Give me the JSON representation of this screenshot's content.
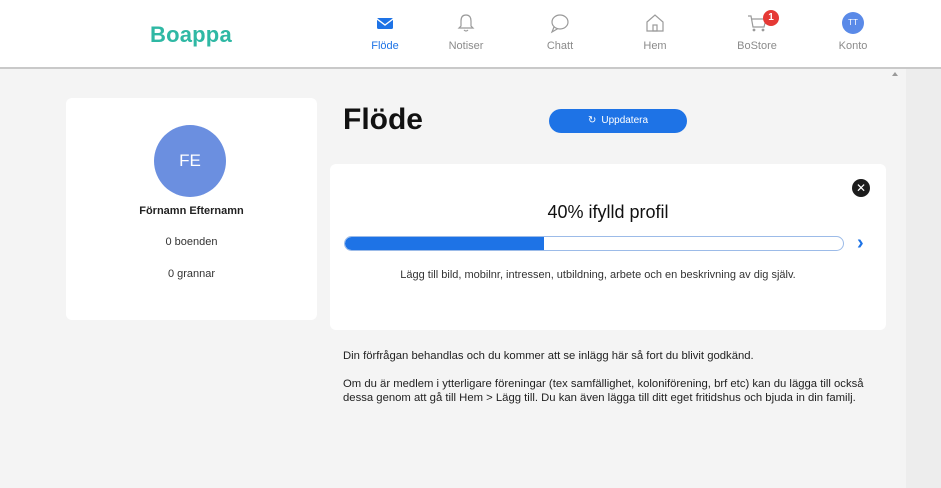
{
  "app": {
    "logo": "Boappa"
  },
  "nav": {
    "items": [
      {
        "label": "Flöde",
        "icon": "envelope-icon",
        "active": true
      },
      {
        "label": "Notiser",
        "icon": "bell-icon"
      },
      {
        "label": "Chatt",
        "icon": "chat-bubble-icon"
      },
      {
        "label": "Hem",
        "icon": "home-icon"
      },
      {
        "label": "BoStore",
        "icon": "cart-icon",
        "badge": "1"
      },
      {
        "label": "Konto",
        "icon": "avatar",
        "initials": "TT"
      }
    ]
  },
  "profile": {
    "initials": "FE",
    "name": "Förnamn Efternamn",
    "residents": "0 boenden",
    "neighbors": "0 grannar"
  },
  "feed": {
    "title": "Flöde",
    "refresh_label": "Uppdatera",
    "refresh_icon": "refresh-icon"
  },
  "profile_progress": {
    "title": "40% ifylld profil",
    "fraction": 0.4,
    "hint": "Lägg till bild, mobilnr, intressen, utbildning, arbete och en beskrivning av dig själv."
  },
  "info": {
    "p1": "Din förfrågan behandlas och du kommer att se inlägg här så fort du blivit godkänd.",
    "p2": "Om du är medlem i ytterligare föreningar (tex samfällighet, koloniförening, brf etc) kan du lägga till också dessa genom att gå till Hem > Lägg till. Du kan även lägga till ditt eget fritidshus och bjuda in din familj."
  },
  "colors": {
    "brand": "#2fb8a4",
    "accent": "#1e73e6",
    "badge": "#e53935"
  }
}
